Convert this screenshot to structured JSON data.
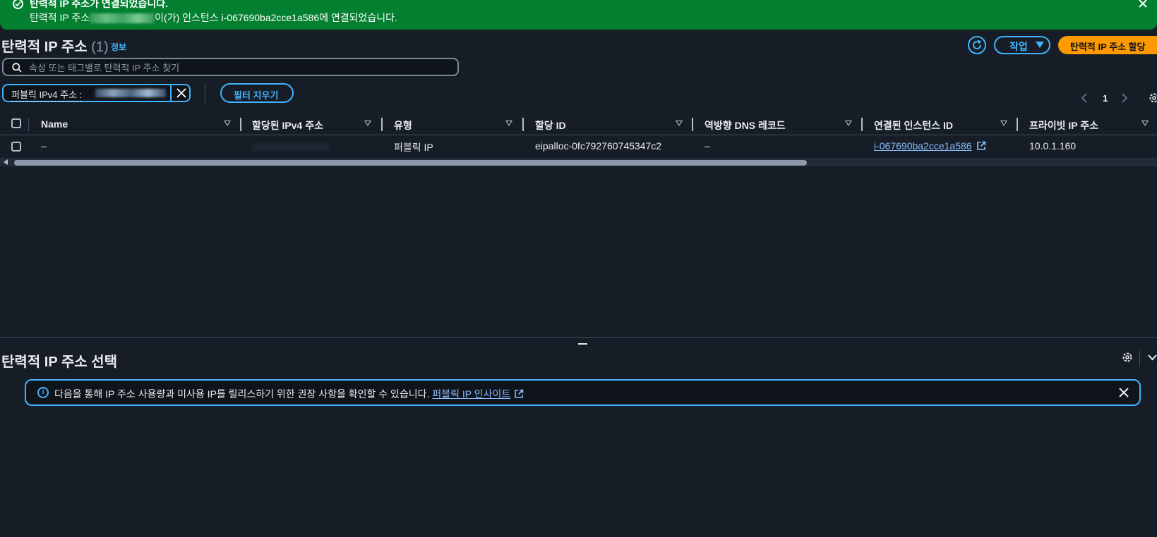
{
  "flash": {
    "title": "탄력적 IP 주소가 연결되었습니다.",
    "message_prefix": "탄력적 IP 주소",
    "message_suffix": "이(가) 인스턴스 i-067690ba2cce1a586에 연결되었습니다.",
    "status_color": "#037f30"
  },
  "header": {
    "title": "탄력적 IP 주소",
    "count": "(1)",
    "info_link": "정보",
    "actions_label": "작업",
    "allocate_label": "탄력적 IP 주소 할당"
  },
  "search": {
    "placeholder": "속성 또는 태그별로 탄력적 IP 주소 찾기"
  },
  "filter": {
    "token_label": "퍼블릭 IPv4 주소 :",
    "clear_label": "필터 지우기"
  },
  "pagination": {
    "current_page": "1"
  },
  "table": {
    "columns": [
      "Name",
      "할당된 IPv4 주소",
      "유형",
      "할당 ID",
      "역방향 DNS 레코드",
      "연결된 인스턴스 ID",
      "프라이빗 IP 주소"
    ],
    "rows": [
      {
        "name": "–",
        "type": "퍼블릭 IP",
        "allocation_id": "eipalloc-0fc792760745347c2",
        "reverse_dns": "–",
        "instance_id": "i-067690ba2cce1a586",
        "private_ip": "10.0.1.160"
      }
    ]
  },
  "split_panel": {
    "title": "탄력적 IP 주소 선택",
    "alert_text": "다음을 통해 IP 주소 사용량과 미사용 IP를 릴리스하기 위한 권장 사항을 확인할 수 있습니다.",
    "alert_link": "퍼블릭 IP 인사이트"
  },
  "colors": {
    "background": "#161d26",
    "accent": "#42b4ff",
    "primary_button": "#ff9900",
    "success": "#037f30"
  }
}
